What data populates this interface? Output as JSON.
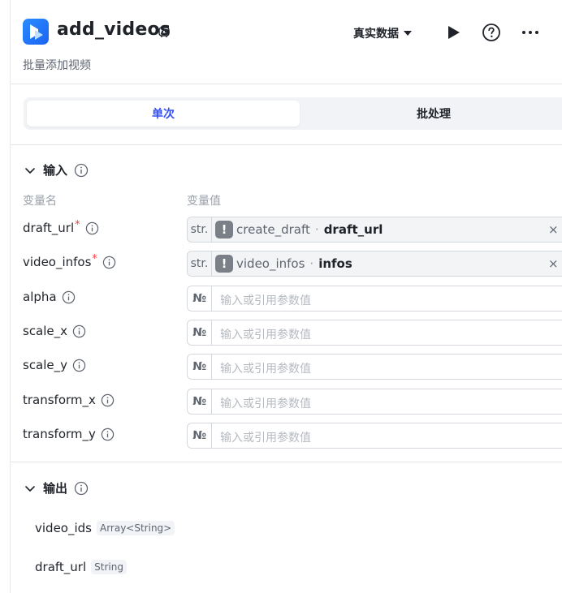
{
  "header": {
    "title": "add_videos",
    "subtitle": "批量添加视频",
    "mode_label": "真实数据",
    "icons": {
      "logo": "video-plugin-icon",
      "title": "plugin-badge-icon",
      "run": "play-icon",
      "help": "help-circle-icon",
      "more": "more-horizontal-icon"
    }
  },
  "tabs": [
    {
      "label": "单次",
      "active": true
    },
    {
      "label": "批处理",
      "active": false
    }
  ],
  "input_section": {
    "title": "输入",
    "col_name": "变量名",
    "col_value": "变量值",
    "params": [
      {
        "name": "draft_url",
        "required": true,
        "type": "str.",
        "ref_node": "create_draft",
        "ref_field": "draft_url"
      },
      {
        "name": "video_infos",
        "required": true,
        "type": "str.",
        "ref_node": "video_infos",
        "ref_field": "infos"
      },
      {
        "name": "alpha",
        "required": false,
        "type": "№",
        "placeholder": "输入或引用参数值"
      },
      {
        "name": "scale_x",
        "required": false,
        "type": "№",
        "placeholder": "输入或引用参数值"
      },
      {
        "name": "scale_y",
        "required": false,
        "type": "№",
        "placeholder": "输入或引用参数值"
      },
      {
        "name": "transform_x",
        "required": false,
        "type": "№",
        "placeholder": "输入或引用参数值"
      },
      {
        "name": "transform_y",
        "required": false,
        "type": "№",
        "placeholder": "输入或引用参数值"
      }
    ],
    "ref_separator": "·",
    "warn_glyph": "!",
    "clear_glyph": "×",
    "required_mark": "*"
  },
  "output_section": {
    "title": "输出",
    "outputs": [
      {
        "name": "video_ids",
        "type": "Array<String>"
      },
      {
        "name": "draft_url",
        "type": "String"
      }
    ]
  },
  "colors": {
    "accent": "#3350f5",
    "required": "#f53f3f",
    "logo": "#1c64f2"
  }
}
